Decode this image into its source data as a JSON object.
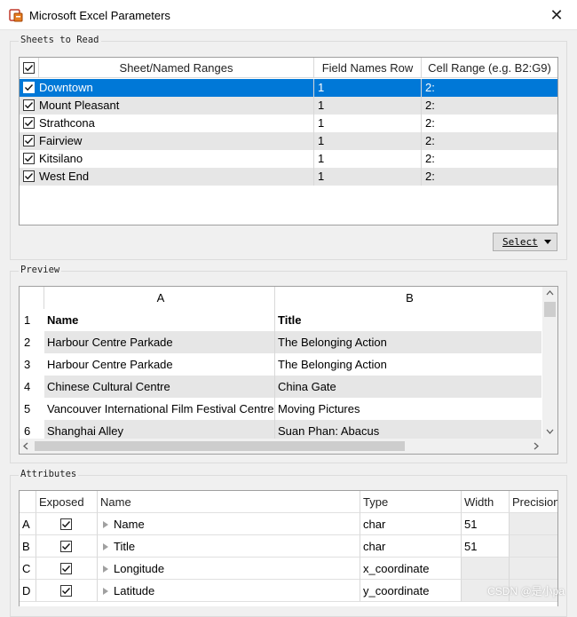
{
  "window": {
    "title": "Microsoft Excel Parameters",
    "close_glyph": "✕"
  },
  "sheets": {
    "legend": "Sheets to Read",
    "columns": [
      "Sheet/Named Ranges",
      "Field Names Row",
      "Cell Range (e.g. B2:G9)"
    ],
    "rows": [
      {
        "name": "Downtown",
        "field_row": "1",
        "range": "2:",
        "checked": true,
        "selected": true
      },
      {
        "name": "Mount Pleasant",
        "field_row": "1",
        "range": "2:",
        "checked": true,
        "selected": false
      },
      {
        "name": "Strathcona",
        "field_row": "1",
        "range": "2:",
        "checked": true,
        "selected": false
      },
      {
        "name": "Fairview",
        "field_row": "1",
        "range": "2:",
        "checked": true,
        "selected": false
      },
      {
        "name": "Kitsilano",
        "field_row": "1",
        "range": "2:",
        "checked": true,
        "selected": false
      },
      {
        "name": "West End",
        "field_row": "1",
        "range": "2:",
        "checked": true,
        "selected": false
      }
    ],
    "select_label": "Select"
  },
  "preview": {
    "legend": "Preview",
    "columns": [
      "A",
      "B"
    ],
    "rows": [
      {
        "num": "1",
        "a": "Name",
        "b": "Title"
      },
      {
        "num": "2",
        "a": "Harbour Centre Parkade",
        "b": "The Belonging Action"
      },
      {
        "num": "3",
        "a": "Harbour Centre Parkade",
        "b": "The Belonging Action"
      },
      {
        "num": "4",
        "a": "Chinese Cultural Centre",
        "b": "China Gate"
      },
      {
        "num": "5",
        "a": "Vancouver International Film Festival Centre",
        "b": "Moving Pictures"
      },
      {
        "num": "6",
        "a": "Shanghai Alley",
        "b": "Suan Phan: Abacus"
      }
    ]
  },
  "attributes": {
    "legend": "Attributes",
    "columns": [
      "Exposed",
      "Name",
      "Type",
      "Width",
      "Precision"
    ],
    "rows": [
      {
        "letter": "A",
        "name": "Name",
        "type": "char",
        "width": "51",
        "precision": ""
      },
      {
        "letter": "B",
        "name": "Title",
        "type": "char",
        "width": "51",
        "precision": ""
      },
      {
        "letter": "C",
        "name": "Longitude",
        "type": "x_coordinate",
        "width": "",
        "precision": ""
      },
      {
        "letter": "D",
        "name": "Latitude",
        "type": "y_coordinate",
        "width": "",
        "precision": ""
      }
    ]
  },
  "watermark": "CSDN @是小pa",
  "colors": {
    "selection": "#0078d7",
    "alt_row": "#e6e6e6",
    "dialog_bg": "#f0f0f0"
  }
}
